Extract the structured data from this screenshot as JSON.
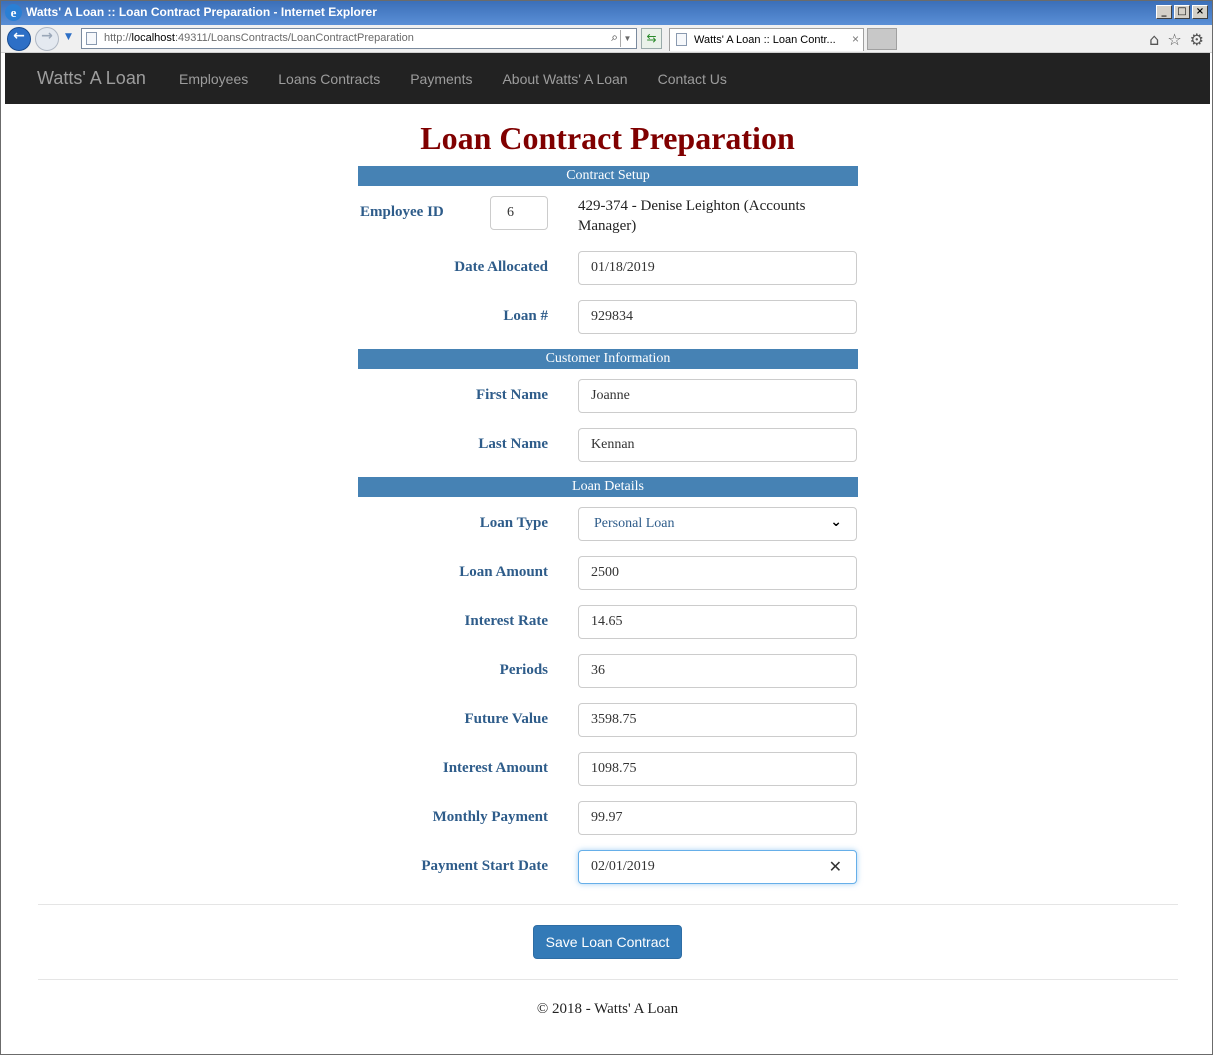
{
  "window": {
    "title": "Watts' A Loan :: Loan Contract Preparation - Internet Explorer",
    "logo_letter": "e"
  },
  "browser": {
    "address_prefix": "http://",
    "address_host": "localhost",
    "address_rest": ":49311/LoansContracts/LoanContractPreparation",
    "tab_title": "Watts' A Loan :: Loan Contr...",
    "icons": [
      "home-icon",
      "star-icon",
      "gear-icon"
    ]
  },
  "navbar": {
    "brand": "Watts' A Loan",
    "links": [
      "Employees",
      "Loans Contracts",
      "Payments",
      "About Watts' A Loan",
      "Contact Us"
    ]
  },
  "page": {
    "title": "Loan Contract Preparation",
    "sections": {
      "contract_setup": "Contract Setup",
      "customer_info": "Customer Information",
      "loan_details": "Loan Details"
    },
    "employee": {
      "label": "Employee ID",
      "value": "6",
      "name": "429-374 - Denise Leighton (Accounts Manager)"
    },
    "fields": {
      "date_allocated": {
        "label": "Date Allocated",
        "value": "01/18/2019"
      },
      "loan_number": {
        "label": "Loan #",
        "value": "929834"
      },
      "first_name": {
        "label": "First Name",
        "value": "Joanne"
      },
      "last_name": {
        "label": "Last Name",
        "value": "Kennan"
      },
      "loan_type": {
        "label": "Loan Type",
        "value": "Personal Loan"
      },
      "loan_amount": {
        "label": "Loan Amount",
        "value": "2500"
      },
      "interest_rate": {
        "label": "Interest Rate",
        "value": "14.65"
      },
      "periods": {
        "label": "Periods",
        "value": "36"
      },
      "future_value": {
        "label": "Future Value",
        "value": "3598.75"
      },
      "interest_amount": {
        "label": "Interest Amount",
        "value": "1098.75"
      },
      "monthly_payment": {
        "label": "Monthly Payment",
        "value": "99.97"
      },
      "payment_start_date": {
        "label": "Payment Start Date",
        "value": "02/01/2019"
      }
    },
    "save_button": "Save Loan Contract",
    "footer": "© 2018 - Watts' A Loan"
  },
  "colors": {
    "title": "#800000",
    "section_bar": "#4682b4",
    "label": "#2e5c8a",
    "button": "#337ab7",
    "navbar": "#222222"
  }
}
